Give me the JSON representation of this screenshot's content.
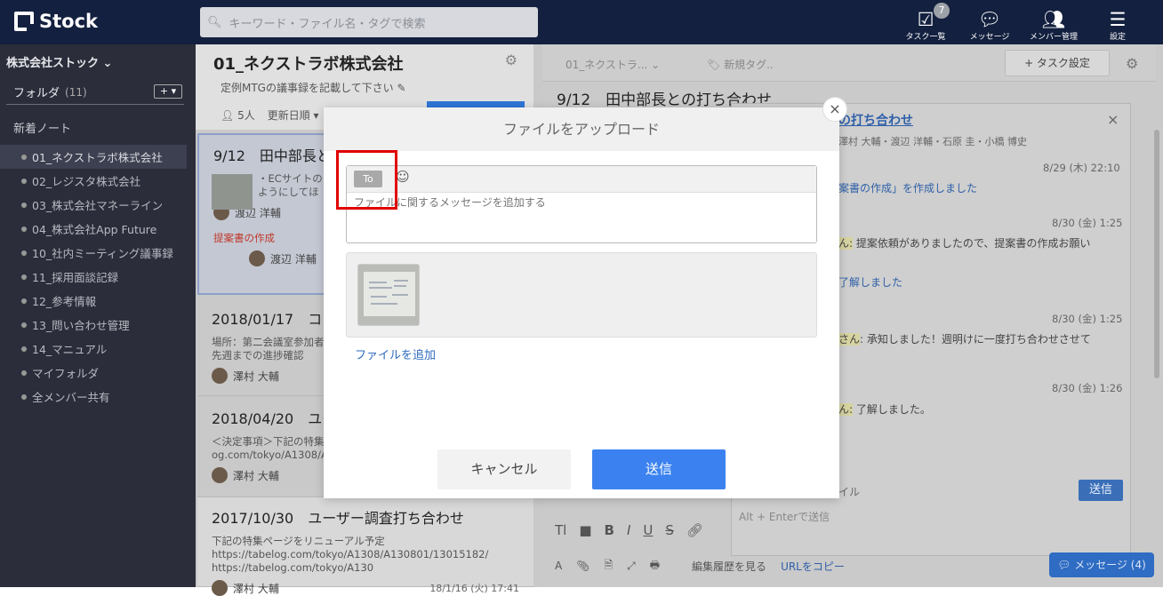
{
  "app": {
    "name": "Stock"
  },
  "search": {
    "placeholder": "キーワード・ファイル名・タグで検索"
  },
  "top_nav": [
    {
      "label": "タスク一覧",
      "icon": "task-check-icon",
      "badge": "7"
    },
    {
      "label": "メッセージ",
      "icon": "chat-bubble-icon"
    },
    {
      "label": "メンバー管理",
      "icon": "members-icon"
    },
    {
      "label": "設定",
      "icon": "menu-icon"
    }
  ],
  "sidebar": {
    "company": "株式会社ストック ⌄",
    "folder_label": "フォルダ",
    "folder_count": "(11)",
    "plus": "+ ▾",
    "new_notes": "新着ノート",
    "folders": [
      "01_ネクストラボ株式会社",
      "02_レジスタ株式会社",
      "03_株式会社マネーライン",
      "04_株式会社App Future",
      "10_社内ミーティング議事録",
      "11_採用面談記録",
      "12_参考情報",
      "13_問い合わせ管理",
      "14_マニュアル",
      "マイフォルダ",
      "全メンバー共有"
    ]
  },
  "notelist": {
    "title": "01_ネクストラボ株式会社",
    "desc": "定例MTGの議事録を記載して下さい",
    "members": "5人",
    "sort": "更新日順 ▾",
    "cards": [
      {
        "title": "9/12　田中部長と",
        "body": "・ECサイトの 内の最終承認 ようにしてほ",
        "user": "渡辺 洋輔",
        "tag": "提案書の作成",
        "user2": "渡辺 洋輔"
      },
      {
        "title": "2018/01/17　コン",
        "body": "場所：第二会議室参加者 橋1. 先週までの進捗確認",
        "user": "澤村 大輔"
      },
      {
        "title": "2018/04/20　ユー",
        "body": "＜決定事項＞下記の特集 og.com/tokyo/A1308/A",
        "user": "澤村 大輔"
      },
      {
        "title": "2017/10/30　ユーザー調査打ち合わせ",
        "body": "下記の特集ページをリニューアル予定 https://tabelog.com/tokyo/A1308/A130801/13015182/ https://tabelog.com/tokyo/A130",
        "user": "澤村 大輔",
        "date": "18/1/16 (火) 17:41"
      }
    ]
  },
  "main": {
    "breadcrumb": "01_ネクストラ... ⌄",
    "tag_placeholder": "新規タグ..",
    "task_button": "+ タスク設定",
    "title": "9/12　田中部長との打ち合わせ",
    "chat": {
      "title": "の打ち合わせ",
      "members": "澤村 大輔・渡辺 洋輔・石原 圭・小橋 博史",
      "entries": [
        {
          "time": "8/29 (木) 22:10",
          "text": "案書の作成」を作成しました"
        },
        {
          "time": "8/30 (金) 1:25",
          "text": "提案依頼がありましたので、提案書の作成お願い",
          "who": "ん:",
          "extra": "了解しました"
        },
        {
          "time": "8/30 (金) 1:25",
          "text": ": 承知しました！週明けに一度打ち合わせさせて",
          "who": "さん"
        },
        {
          "time": "8/30 (金) 1:26",
          "text": "了解しました。",
          "who": "ん:"
        }
      ],
      "file_label": "イル",
      "send": "送信",
      "hint": "Alt + Enterで送信"
    },
    "bottom": {
      "history": "編集履歴を見る",
      "copy_url": "URLをコピー",
      "message": "メッセージ (4)"
    }
  },
  "modal": {
    "title": "ファイルをアップロード",
    "to": "To",
    "emoji": "☺",
    "placeholder": "ファイルに関するメッセージを追加する",
    "add_file": "ファイルを追加",
    "cancel": "キャンセル",
    "send": "送信",
    "close": "×"
  }
}
